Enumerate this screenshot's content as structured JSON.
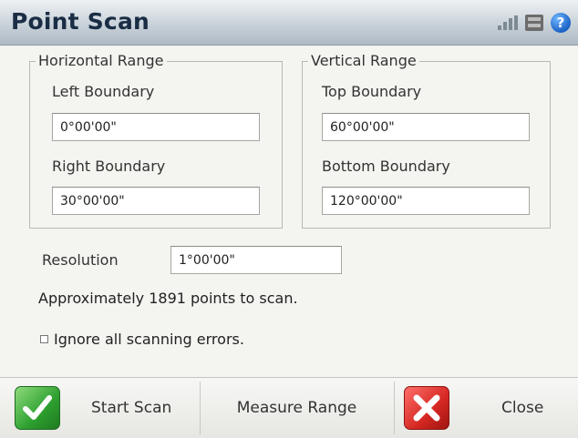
{
  "window": {
    "title": "Point Scan"
  },
  "icons": {
    "satellite": "satellite-signal-icon",
    "battery": "battery-icon",
    "help": "help-icon"
  },
  "help_glyph": "?",
  "horizontal": {
    "legend": "Horizontal Range",
    "left_label": "Left Boundary",
    "left_value": "0°00'00\"",
    "right_label": "Right Boundary",
    "right_value": "30°00'00\""
  },
  "vertical": {
    "legend": "Vertical Range",
    "top_label": "Top Boundary",
    "top_value": "60°00'00\"",
    "bottom_label": "Bottom Boundary",
    "bottom_value": "120°00'00\""
  },
  "resolution": {
    "label": "Resolution",
    "value": "1°00'00\""
  },
  "info_text": "Approximately 1891 points to scan.",
  "ignore_errors": {
    "label": "Ignore all scanning errors.",
    "checked": false
  },
  "footer": {
    "start_label": "Start Scan",
    "measure_label": "Measure Range",
    "close_label": "Close"
  },
  "colors": {
    "title": "#1a2d44",
    "ok_green": "#2d9f2f",
    "close_red": "#d52722",
    "help_blue": "#1b62c4"
  }
}
